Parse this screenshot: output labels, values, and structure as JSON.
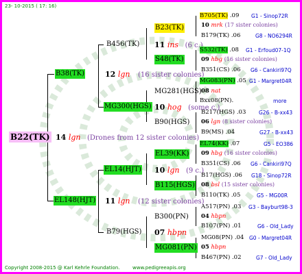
{
  "header": {
    "date": "23- 10-2015 ( 17: 16)"
  },
  "footer": {
    "copyright": "Copyright 2008-2015 @ Karl Kehrle Foundation.",
    "site": "www.pedigreeapis.org"
  },
  "colors": {
    "frame": "#ff00ff",
    "green_hl": "#22dd22",
    "yellow_hl": "#ffee00",
    "pink_hl": "#f7bff7",
    "link_blue": "#0000cc",
    "drone_purple": "#7a3fa0"
  },
  "root": {
    "name": "B22(TK)",
    "num": "14",
    "ins": "lgn",
    "desc": "(Drones from 12 sister colonies)"
  },
  "gen1": [
    {
      "name": "B38(TK)",
      "num": "12",
      "ins": "lgn",
      "desc": "(16 sister colonies)"
    },
    {
      "name": "EL148(HJT)",
      "num": "11",
      "ins": "lgn",
      "desc": "(12 sister colonies)"
    }
  ],
  "gen2": [
    {
      "name": "B456(TK)"
    },
    {
      "name": "MG300(HGS)",
      "num": "10",
      "ins": "hog",
      "desc": "(some c.)"
    },
    {
      "name": "EL14(HJT)",
      "num": "10",
      "ins": "lgn",
      "desc": "(9 c.)"
    },
    {
      "name": "B79(HGS)",
      "num": "07",
      "ins": "hbpn"
    }
  ],
  "gen3": [
    {
      "name": "B23(TK)",
      "num": "11",
      "ins": "ins",
      "desc": "(6 c.)"
    },
    {
      "name": "S48(TK)"
    },
    {
      "name": "MG281(HGS)"
    },
    {
      "name": "B90(HGS)"
    },
    {
      "name": "EL39(KK)"
    },
    {
      "name": "B115(HGS)"
    },
    {
      "name": "B300(PN)"
    },
    {
      "name": "MG081(PN)"
    }
  ],
  "gen4": [
    {
      "name": "B705(TK)",
      "val": ".09",
      "col": "G1 - Sinop72R"
    },
    {
      "num": "10",
      "ins": "mrk",
      "desc": "(17 sister colonies)"
    },
    {
      "name": "B179(TK)",
      "val": ".06",
      "col": "G8 - NO6294R"
    },
    {
      "name": "S532(TK)",
      "val": ".08",
      "col": "G1 - Erfoud07-1Q"
    },
    {
      "num": "09",
      "ins": "hbg",
      "desc": "(16 sister colonies)"
    },
    {
      "name": "B351(CS)",
      "val": ".06",
      "col": "G6 - Cankiri97Q"
    },
    {
      "name": "MG083(PN)",
      "val": ".05",
      "col": "G1 - Margret04R"
    },
    {
      "num": "08",
      "ins": "nat"
    },
    {
      "name": "Bxx08(PN)",
      "val": ".",
      "col": "more"
    },
    {
      "name": "B217(HGS)",
      "val": ".03",
      "col": "G26 - B-xx43"
    },
    {
      "num": "06",
      "ins": "lgn",
      "desc": "(8 sister colonies)"
    },
    {
      "name": "B9(MS)",
      "val": ".04",
      "col": "G27 - B-xx43"
    },
    {
      "name": "EL74(KK)",
      "val": ".07",
      "col": "G5 - EO386"
    },
    {
      "num": "09",
      "ins": "hbg",
      "desc": "(16 sister colonies)"
    },
    {
      "name": "B351(CS)",
      "val": ".06",
      "col": "G6 - Cankiri97Q"
    },
    {
      "name": "B17(HGS)",
      "val": ".06",
      "col": "G18 - Sinop72R"
    },
    {
      "num": "08",
      "ins": "bsl",
      "desc": "(15 sister colonies)"
    },
    {
      "name": "B110(TK)",
      "val": ".05",
      "col": "G5 - MG00R"
    },
    {
      "name": "A517(PN)",
      "val": ".03",
      "col": "G3 - Bayburt98-3"
    },
    {
      "num": "04",
      "ins": "hbpn"
    },
    {
      "name": "B107(PN)",
      "val": ".01",
      "col": "G6 - Old_Lady"
    },
    {
      "name": "MG08(PN)",
      "val": ".04",
      "col": "G0 - Margret04R"
    },
    {
      "num": "05",
      "ins": "hbpn"
    },
    {
      "name": "B467(PN)",
      "val": ".02",
      "col": "G7 - Old_Lady"
    }
  ]
}
